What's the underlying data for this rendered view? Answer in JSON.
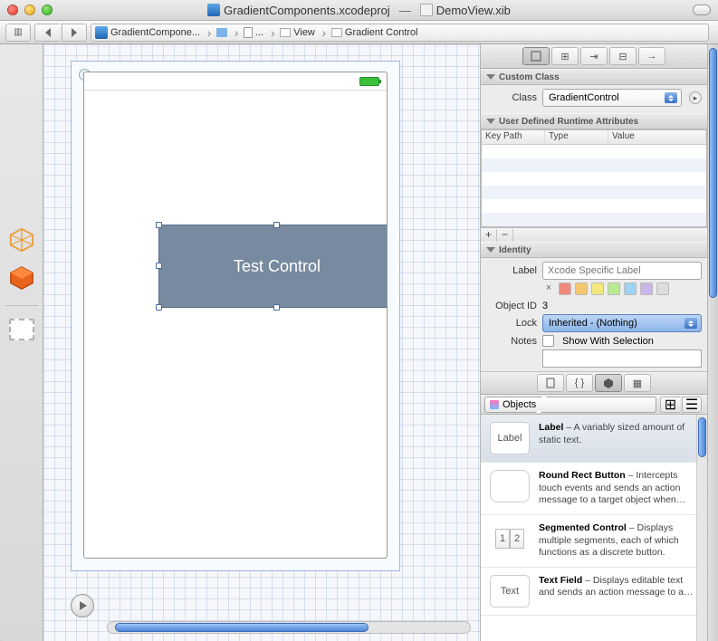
{
  "window": {
    "project_title": "GradientComponents.xcodeproj",
    "document_title": "DemoView.xib",
    "separator": "—"
  },
  "breadcrumb": {
    "project": "GradientCompone...",
    "separator_glyph": "›",
    "file": "...",
    "root_obj": "View",
    "selected_obj": "Gradient Control"
  },
  "canvas": {
    "control_text": "Test Control"
  },
  "inspector": {
    "custom_class": {
      "header": "Custom Class",
      "class_label": "Class",
      "class_value": "GradientControl"
    },
    "user_attrs": {
      "header": "User Defined Runtime Attributes",
      "col_key": "Key Path",
      "col_type": "Type",
      "col_value": "Value",
      "plus": "+",
      "minus": "−"
    },
    "identity": {
      "header": "Identity",
      "label_label": "Label",
      "label_placeholder": "Xcode Specific Label",
      "objectid_label": "Object ID",
      "objectid_value": "3",
      "lock_label": "Lock",
      "lock_value": "Inherited - (Nothing)",
      "notes_label": "Notes",
      "notes_checkbox_label": "Show With Selection"
    },
    "label_colors": [
      "#ffffff",
      "#f08b7c",
      "#f6c66f",
      "#f3e87b",
      "#b9ea90",
      "#9fd2f5",
      "#c9b6ea",
      "#dcdcdc"
    ]
  },
  "library": {
    "popup_label": "Objects",
    "items": [
      {
        "thumb_text": "Label",
        "title": "Label",
        "desc": " – A variably sized amount of static text.",
        "selected": true
      },
      {
        "thumb_text": "",
        "title": "Round Rect Button",
        "desc": " – Intercepts touch events and sends an action message to a target object when…",
        "selected": false
      },
      {
        "thumb_text": "1 2",
        "title": "Segmented Control",
        "desc": " – Displays multiple segments, each of which functions as a discrete button.",
        "selected": false
      },
      {
        "thumb_text": "Text",
        "title": "Text Field",
        "desc": " – Displays editable text and sends an action message to a…",
        "selected": false
      }
    ]
  }
}
